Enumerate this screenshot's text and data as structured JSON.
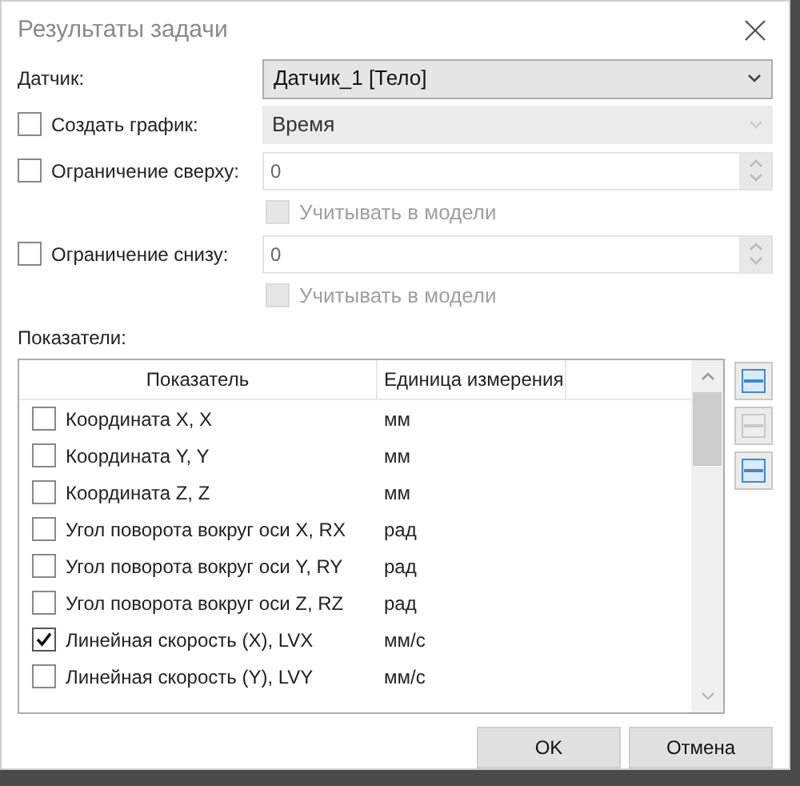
{
  "window": {
    "title": "Результаты задачи"
  },
  "sensor": {
    "label": "Датчик:",
    "value": "Датчик_1 [Тело]",
    "disabled": false
  },
  "create_chart": {
    "label": "Создать график:",
    "checked": false,
    "value": "Время",
    "disabled": true
  },
  "limits": [
    {
      "label": "Ограничение сверху:",
      "checked": false,
      "value": "0",
      "disabled": true,
      "account": {
        "label": "Учитывать в модели",
        "checked": false,
        "disabled": true
      }
    },
    {
      "label": "Ограничение снизу:",
      "checked": false,
      "value": "0",
      "disabled": true,
      "account": {
        "label": "Учитывать в модели",
        "checked": false,
        "disabled": true
      }
    }
  ],
  "indicators_label": "Показатели:",
  "table": {
    "columns": [
      "Показатель",
      "Единица измерения"
    ],
    "rows": [
      {
        "name": "Координата X, X",
        "unit": "мм",
        "checked": false
      },
      {
        "name": "Координата Y, Y",
        "unit": "мм",
        "checked": false
      },
      {
        "name": "Координата Z, Z",
        "unit": "мм",
        "checked": false
      },
      {
        "name": "Угол поворота вокруг оси X, RX",
        "unit": "рад",
        "checked": false
      },
      {
        "name": "Угол поворота вокруг оси Y, RY",
        "unit": "рад",
        "checked": false
      },
      {
        "name": "Угол поворота вокруг оси Z, RZ",
        "unit": "рад",
        "checked": false
      },
      {
        "name": "Линейная скорость (X), LVX",
        "unit": "мм/с",
        "checked": true
      },
      {
        "name": "Линейная скорость (Y), LVY",
        "unit": "мм/с",
        "checked": false
      }
    ]
  },
  "side_buttons": [
    {
      "disabled": false
    },
    {
      "disabled": true
    },
    {
      "disabled": false
    }
  ],
  "buttons": [
    "OK",
    "Отмена"
  ]
}
